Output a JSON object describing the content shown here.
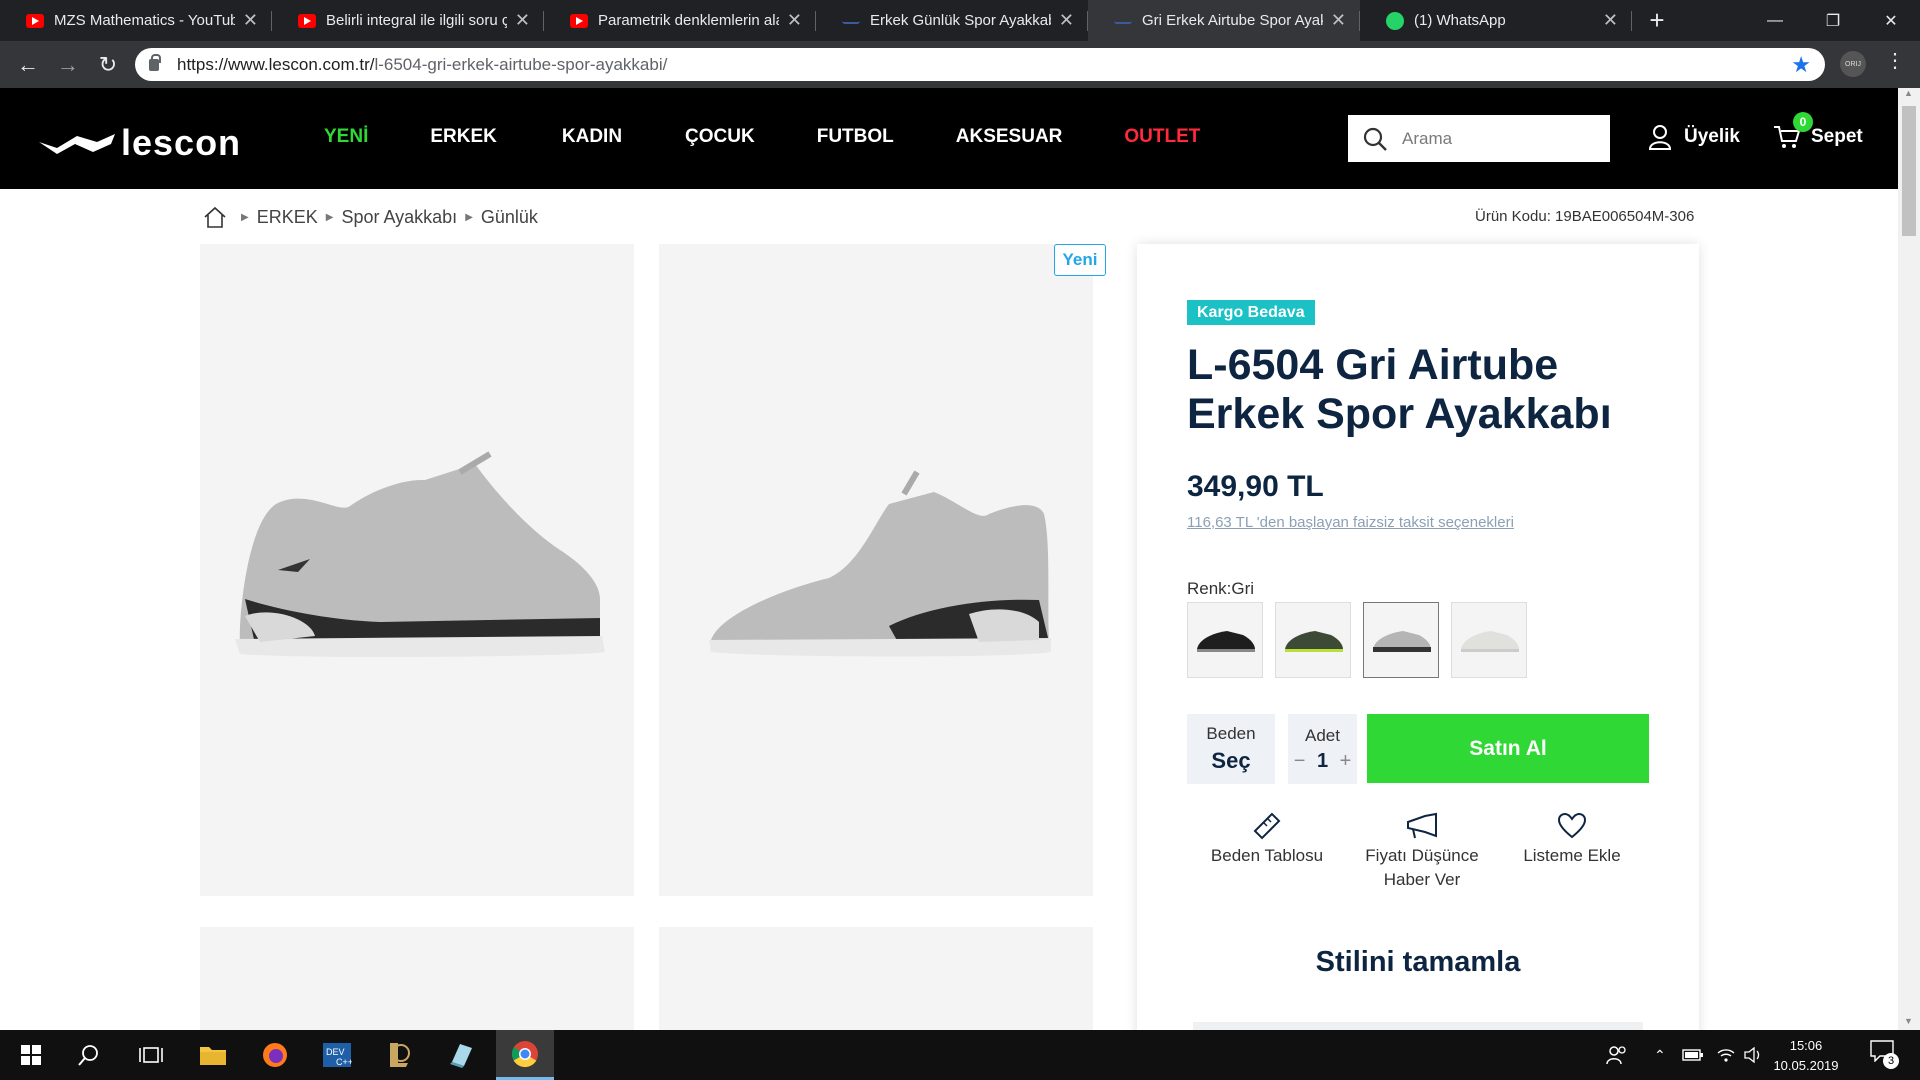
{
  "browser": {
    "tabs": [
      {
        "title": "MZS Mathematics - YouTube",
        "icon": "youtube-icon"
      },
      {
        "title": "Belirli integral ile ilgili soru çö",
        "icon": "youtube-icon"
      },
      {
        "title": "Parametrik denklemlerin alan",
        "icon": "youtube-icon"
      },
      {
        "title": "Erkek Günlük Spor Ayakkabı",
        "icon": "lescon-icon"
      },
      {
        "title": "Gri Erkek Airtube Spor Ayakk",
        "icon": "lescon-icon"
      },
      {
        "title": "(1) WhatsApp",
        "icon": "whatsapp-icon"
      }
    ],
    "url_host": "https://www.lescon.com.tr/",
    "url_path": "l-6504-gri-erkek-airtube-spor-ayakkabi/",
    "extension_label": "ORIJ"
  },
  "site": {
    "logo_text": "lescon",
    "nav": [
      {
        "label": "YENİ",
        "color": "#2fd834"
      },
      {
        "label": "ERKEK",
        "color": "#ffffff"
      },
      {
        "label": "KADIN",
        "color": "#ffffff"
      },
      {
        "label": "ÇOCUK",
        "color": "#ffffff"
      },
      {
        "label": "FUTBOL",
        "color": "#ffffff"
      },
      {
        "label": "AKSESUAR",
        "color": "#ffffff"
      },
      {
        "label": "OUTLET",
        "color": "#ff2a3a"
      }
    ],
    "search_placeholder": "Arama",
    "account_label": "Üyelik",
    "cart_label": "Sepet",
    "cart_count": "0"
  },
  "breadcrumb": [
    "ERKEK",
    "Spor Ayakkabı",
    "Günlük"
  ],
  "product": {
    "code_text": "Ürün Kodu: 19BAE006504M-306",
    "new_badge": "Yeni",
    "kargo_badge": "Kargo Bedava",
    "title": "L-6504 Gri Airtube Erkek Spor Ayakkabı",
    "price": "349,90 TL",
    "installment": "116,63 TL 'den başlayan faizsiz taksit seçenekleri",
    "color_label": "Renk:Gri",
    "swatches": [
      "siyah",
      "haki",
      "gri",
      "beyaz"
    ],
    "size_label": "Beden",
    "size_value": "Seç",
    "qty_label": "Adet",
    "qty_minus": "−",
    "qty_value": "1",
    "qty_plus": "+",
    "buy_label": "Satın Al",
    "actions": [
      {
        "label": "Beden Tablosu",
        "icon": "ruler-icon"
      },
      {
        "label": "Fiyatı Düşünce Haber Ver",
        "icon": "megaphone-icon"
      },
      {
        "label": "Listeme Ekle",
        "icon": "heart-icon"
      }
    ],
    "complete_style": "Stilini tamamla"
  },
  "taskbar": {
    "time": "15:06",
    "date": "10.05.2019",
    "notifications": "3"
  },
  "colors": {
    "accent_green": "#2fd834",
    "navy": "#0e2541",
    "outlet_red": "#ff2a3a",
    "kargo_teal": "#1cc1c6"
  }
}
